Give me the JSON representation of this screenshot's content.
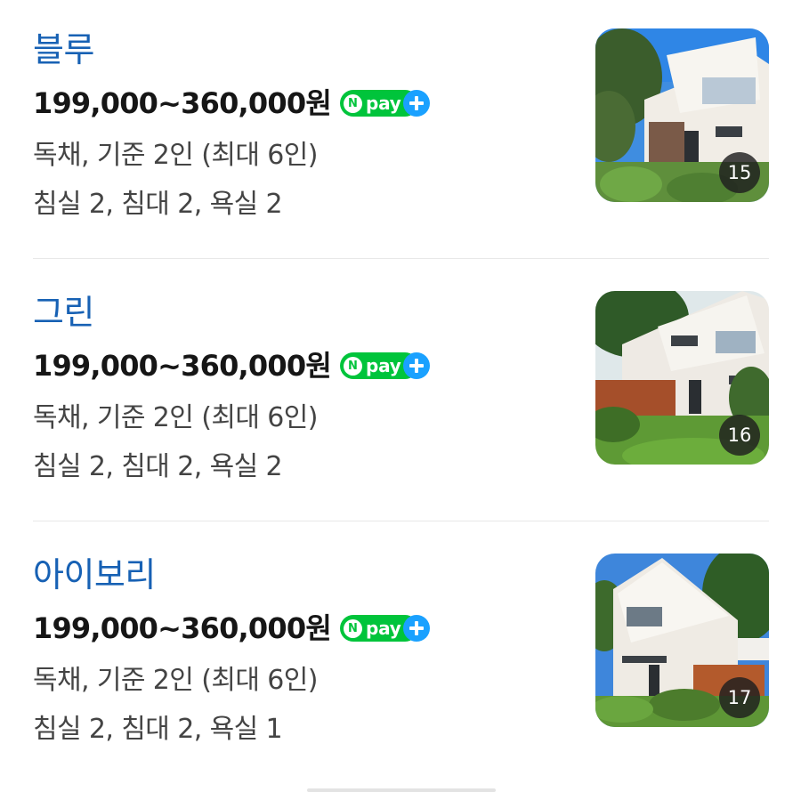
{
  "listings": [
    {
      "name": "블루",
      "price": "199,000~360,000원",
      "npay": "pay",
      "type_capacity": "독채, 기준 2인 (최대 6인)",
      "rooms": "침실 2, 침대 2, 욕실 2",
      "photo_count": "15"
    },
    {
      "name": "그린",
      "price": "199,000~360,000원",
      "npay": "pay",
      "type_capacity": "독채, 기준 2인 (최대 6인)",
      "rooms": "침실 2, 침대 2, 욕실 2",
      "photo_count": "16"
    },
    {
      "name": "아이보리",
      "price": "199,000~360,000원",
      "npay": "pay",
      "type_capacity": "독채, 기준 2인 (최대 6인)",
      "rooms": "침실 2, 침대 2, 욕실 1",
      "photo_count": "17"
    }
  ],
  "colors": {
    "room_name": "#1761b4",
    "npay_green": "#00c43b",
    "npay_plus_blue": "#1aa1ff"
  }
}
